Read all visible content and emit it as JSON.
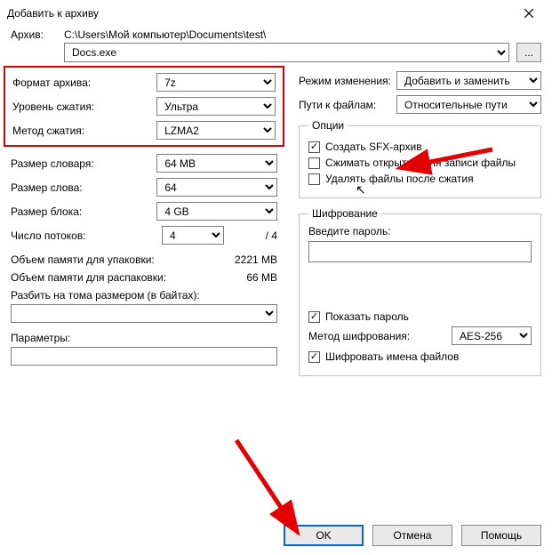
{
  "title": "Добавить к архиву",
  "archive": {
    "label": "Архив:",
    "path": "C:\\Users\\Мой компьютер\\Documents\\test\\",
    "filename": "Docs.exe",
    "browse": "..."
  },
  "left": {
    "format_label": "Формат архива:",
    "format_value": "7z",
    "level_label": "Уровень сжатия:",
    "level_value": "Ультра",
    "method_label": "Метод сжатия:",
    "method_value": "LZMA2",
    "dict_label": "Размер словаря:",
    "dict_value": "64 MB",
    "word_label": "Размер слова:",
    "word_value": "64",
    "block_label": "Размер блока:",
    "block_value": "4 GB",
    "threads_label": "Число потоков:",
    "threads_value": "4",
    "threads_total": "/ 4",
    "mem_pack_label": "Объем памяти для упаковки:",
    "mem_pack_value": "2221 MB",
    "mem_unpack_label": "Объем памяти для распаковки:",
    "mem_unpack_value": "66 MB",
    "split_label": "Разбить на тома размером (в байтах):",
    "params_label": "Параметры:"
  },
  "right": {
    "update_label": "Режим изменения:",
    "update_value": "Добавить и заменить",
    "paths_label": "Пути к файлам:",
    "paths_value": "Относительные пути",
    "options_legend": "Опции",
    "sfx_label": "Создать SFX-архив",
    "shared_label": "Сжимать открытые для записи файлы",
    "delete_label": "Удалять файлы после сжатия",
    "enc_legend": "Шифрование",
    "pwd_label": "Введите пароль:",
    "show_pwd_label": "Показать пароль",
    "enc_method_label": "Метод шифрования:",
    "enc_method_value": "AES-256",
    "enc_names_label": "Шифровать имена файлов"
  },
  "buttons": {
    "ok": "OK",
    "cancel": "Отмена",
    "help": "Помощь"
  }
}
